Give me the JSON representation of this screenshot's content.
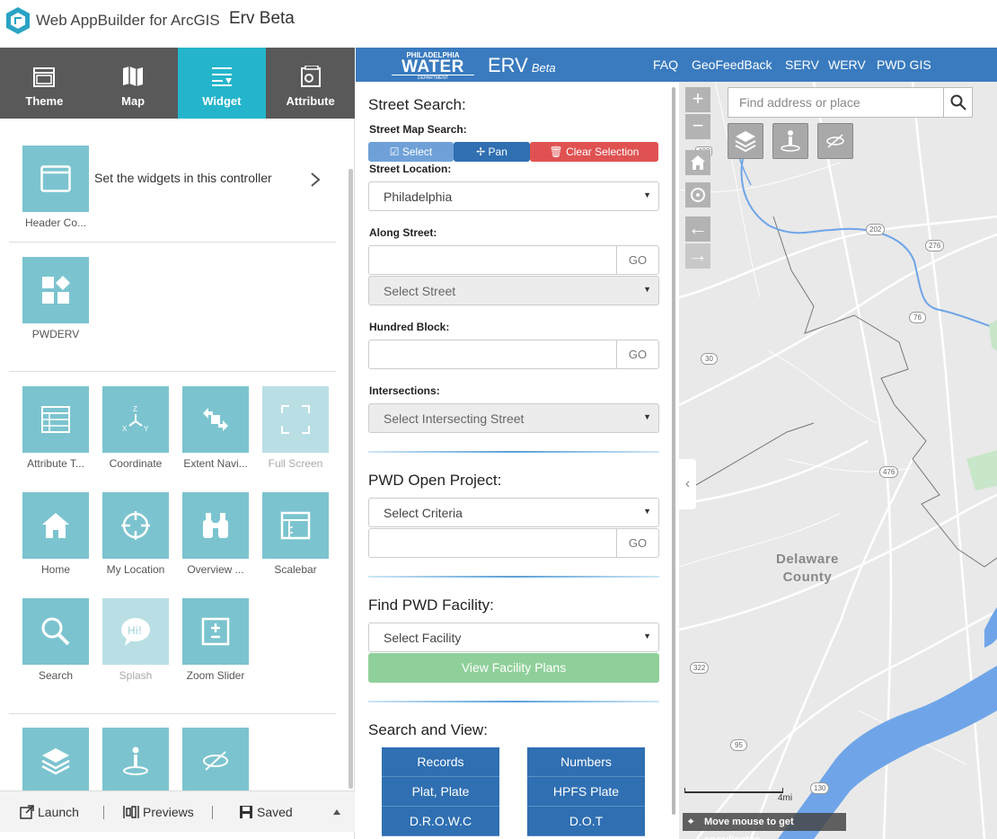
{
  "app": {
    "builder_title": "Web AppBuilder for ArcGIS",
    "app_name": "Erv Beta"
  },
  "left_panel": {
    "tabs": [
      {
        "label": "Theme",
        "icon": "theme-icon",
        "active": false
      },
      {
        "label": "Map",
        "icon": "map-icon",
        "active": false
      },
      {
        "label": "Widget",
        "icon": "widget-icon",
        "active": true
      },
      {
        "label": "Attribute",
        "icon": "attribute-icon",
        "active": false
      }
    ],
    "header_controller": {
      "label": "Header Co...",
      "description": "Set the widgets in this controller"
    },
    "custom_widget": {
      "label": "PWDERV"
    },
    "widgets": [
      {
        "label": "Attribute T...",
        "icon": "attribute-table-icon",
        "enabled": true
      },
      {
        "label": "Coordinate",
        "icon": "coordinate-icon",
        "enabled": true
      },
      {
        "label": "Extent Navi...",
        "icon": "extent-navigate-icon",
        "enabled": true
      },
      {
        "label": "Full Screen",
        "icon": "full-screen-icon",
        "enabled": false
      },
      {
        "label": "Home",
        "icon": "home-icon",
        "enabled": true
      },
      {
        "label": "My Location",
        "icon": "my-location-icon",
        "enabled": true
      },
      {
        "label": "Overview ...",
        "icon": "overview-map-icon",
        "enabled": true
      },
      {
        "label": "Scalebar",
        "icon": "scalebar-icon",
        "enabled": true
      },
      {
        "label": "Search",
        "icon": "search-icon",
        "enabled": true
      },
      {
        "label": "Splash",
        "icon": "splash-icon",
        "enabled": false
      },
      {
        "label": "Zoom Slider",
        "icon": "zoom-slider-icon",
        "enabled": true
      }
    ],
    "bottom_bar": {
      "launch": "Launch",
      "previews": "Previews",
      "saved": "Saved"
    }
  },
  "erv_header": {
    "logo_line1": "PHILADELPHIA",
    "logo_line2": "WATER",
    "logo_line3": "DEPARTMENT",
    "title": "ERV",
    "beta": "Beta",
    "links": [
      "FAQ",
      "GeoFeedBack",
      "SERV",
      "WERV",
      "PWD GIS"
    ]
  },
  "street_search": {
    "title": "Street Search:",
    "map_search_label": "Street Map Search:",
    "select_btn": "Select",
    "pan_btn": "Pan",
    "clear_btn": "Clear Selection",
    "location_label": "Street Location:",
    "location_value": "Philadelphia",
    "along_label": "Along Street:",
    "go": "GO",
    "select_street": "Select Street",
    "hundred_label": "Hundred Block:",
    "intersections_label": "Intersections:",
    "select_intersecting": "Select Intersecting Street"
  },
  "open_project": {
    "title": "PWD Open Project:",
    "select_criteria": "Select Criteria",
    "go": "GO"
  },
  "facility": {
    "title": "Find PWD Facility:",
    "select_facility": "Select Facility",
    "view_plans": "View Facility Plans"
  },
  "search_view": {
    "title": "Search and View:",
    "left_buttons": [
      "Records",
      "Plat, Plate",
      "D.R.O.W.C"
    ],
    "right_buttons": [
      "Numbers",
      "HPFS Plate",
      "D.O.T"
    ]
  },
  "map": {
    "search_placeholder": "Find address or place",
    "county_line1": "Delaware",
    "county_line2": "County",
    "scale_label": "4mi",
    "coords_text": "Move mouse to get coordinates",
    "route_shields": [
      "422",
      "202",
      "276",
      "76",
      "30",
      "476",
      "322",
      "95",
      "130"
    ],
    "colors": {
      "water": "#6fa5e8",
      "land": "#e9e9e9",
      "park": "#c8e6c9"
    }
  },
  "colors": {
    "tab_bg": "#595959",
    "tab_active": "#24b5cc",
    "tile": "#7bc4cf",
    "header_blue": "#3a7bbf",
    "select_btn": "#6fa1d8",
    "pan_btn": "#2f6fb2",
    "clear_btn": "#e05252",
    "facility_btn": "#8fd09a"
  }
}
